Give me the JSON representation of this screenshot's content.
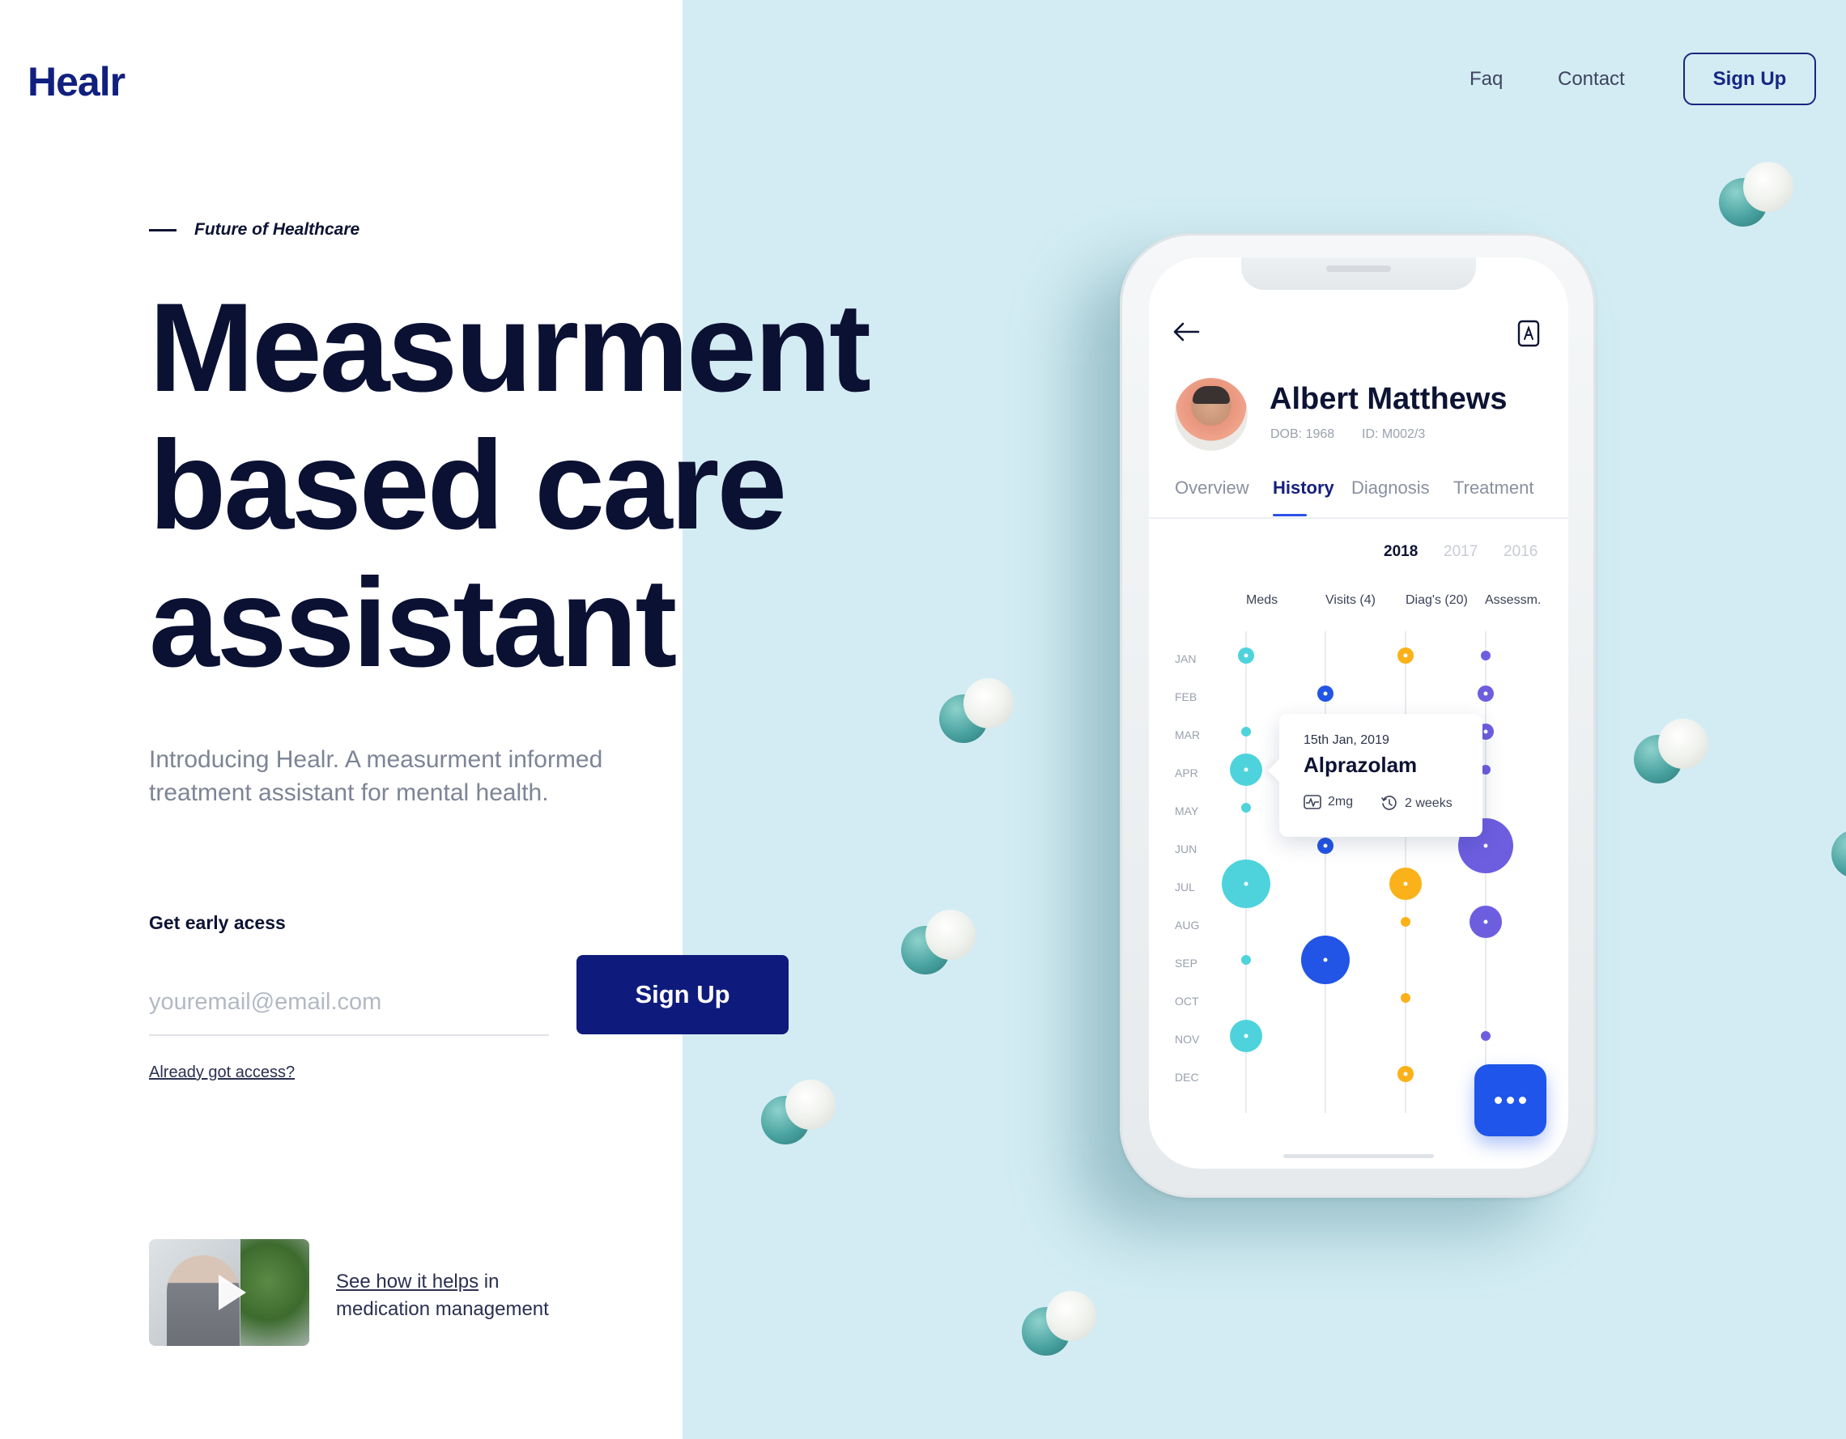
{
  "brand": {
    "logo": "Healr"
  },
  "nav": {
    "faq": "Faq",
    "contact": "Contact",
    "signup": "Sign Up"
  },
  "hero": {
    "eyebrow": "Future of Healthcare",
    "title_lines": [
      "Measurment",
      "based care",
      "assistant"
    ],
    "intro": "Introducing Healr. A measurment informed treatment assistant for mental health.",
    "early_access_label": "Get early acess",
    "email_placeholder": "youremail@email.com",
    "signup_button": "Sign Up",
    "already_link": "Already got access?"
  },
  "video": {
    "link_text": "See how it helps",
    "caption_rest": " in",
    "caption_line2": "medication management"
  },
  "phone": {
    "patient": {
      "name": "Albert Matthews",
      "dob": "DOB: 1968",
      "id": "ID: M002/3"
    },
    "tabs": [
      "Overview",
      "History",
      "Diagnosis",
      "Treatment"
    ],
    "active_tab": "History",
    "years": [
      "2018",
      "2017",
      "2016"
    ],
    "active_year": "2018",
    "columns": [
      "Meds",
      "Visits (4)",
      "Diag's (20)",
      "Assessm."
    ],
    "months": [
      "JAN",
      "FEB",
      "MAR",
      "APR",
      "MAY",
      "JUN",
      "JUL",
      "AUG",
      "SEP",
      "OCT",
      "NOV",
      "DEC"
    ],
    "tooltip": {
      "date": "15th Jan, 2019",
      "drug": "Alprazolam",
      "dose": "2mg",
      "duration": "2 weeks"
    },
    "icons": [
      "back-arrow-icon",
      "bookmark-icon",
      "pulse-icon",
      "history-clock-icon",
      "more-dots-icon"
    ],
    "colors": {
      "meds": "#4ed3dc",
      "visits": "#2255e6",
      "diags": "#fbb11a",
      "assess": "#6d5ee0",
      "brand": "#0f1b7c"
    }
  },
  "chart_data": {
    "type": "scatter",
    "categories": [
      "Meds",
      "Visits (4)",
      "Diag's (20)",
      "Assessm."
    ],
    "series": [
      {
        "name": "Meds",
        "points": [
          {
            "month": "JAN",
            "size": "small"
          },
          {
            "month": "MAR",
            "size": "tiny"
          },
          {
            "month": "APR",
            "size": "medium"
          },
          {
            "month": "MAY",
            "size": "tiny"
          },
          {
            "month": "JUL",
            "size": "large"
          },
          {
            "month": "SEP",
            "size": "tiny"
          },
          {
            "month": "NOV",
            "size": "medium"
          }
        ]
      },
      {
        "name": "Visits (4)",
        "points": [
          {
            "month": "FEB",
            "size": "small"
          },
          {
            "month": "JUN",
            "size": "small"
          },
          {
            "month": "SEP",
            "size": "large"
          }
        ]
      },
      {
        "name": "Diag's (20)",
        "points": [
          {
            "month": "JAN",
            "size": "small"
          },
          {
            "month": "JUL",
            "size": "medium"
          },
          {
            "month": "AUG",
            "size": "tiny"
          },
          {
            "month": "OCT",
            "size": "tiny"
          },
          {
            "month": "DEC",
            "size": "small"
          }
        ]
      },
      {
        "name": "Assessm.",
        "points": [
          {
            "month": "JAN",
            "size": "tiny"
          },
          {
            "month": "FEB",
            "size": "small"
          },
          {
            "month": "MAR",
            "size": "small"
          },
          {
            "month": "APR",
            "size": "tiny"
          },
          {
            "month": "JUN",
            "size": "xlarge"
          },
          {
            "month": "AUG",
            "size": "medium"
          },
          {
            "month": "NOV",
            "size": "tiny"
          }
        ]
      }
    ]
  }
}
